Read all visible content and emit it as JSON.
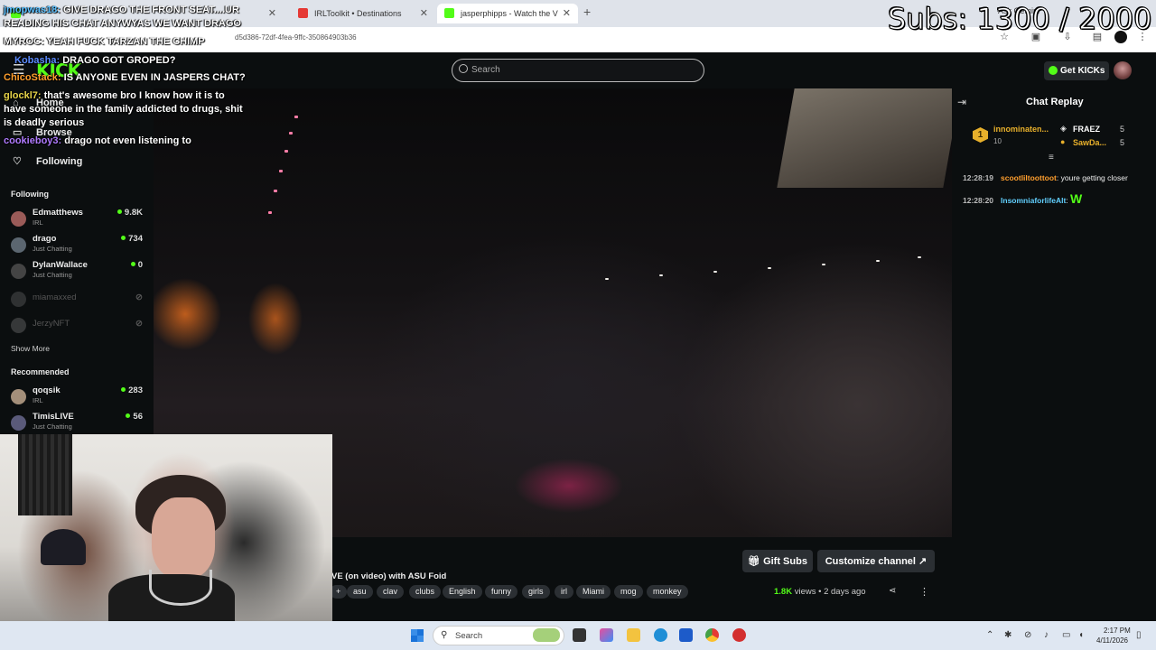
{
  "browser": {
    "tabs": [
      {
        "label": "jmopwas18: GIVE DRAGO THE FRONT SEAT",
        "favicon_color": "#53fc18"
      },
      {
        "label": "IRLToolkit • Destinations",
        "favicon_color": "#e53935"
      },
      {
        "label": "jasperphipps - Watch the V",
        "favicon_color": "#53fc18",
        "active": true
      }
    ],
    "new_tab": "+",
    "url": "d5d386-72df-4fea-9ffc-350864903b36",
    "gemini_label": "Ask Gemini"
  },
  "overlay": {
    "subs_counter": "Subs: 1300 / 2000",
    "chat": [
      {
        "user": "jmopwas18:",
        "text": "GIVE DRAGO THE FRONT SEAT....UR",
        "color": "#5bc0ff"
      },
      {
        "user": "",
        "text": "READING HIS CHAT ANYWYAS WE WANT DRAGO",
        "color": "#ffffff"
      },
      {
        "user": "MYROC:",
        "text": "YEAH FUCK TARZAN THE CHIMP",
        "color": "#ffffff"
      },
      {
        "user": "Kobasha:",
        "text": "DRAGO GOT GROPED?",
        "color": "#5b8bff"
      },
      {
        "user": "ChicoStack:",
        "text": "IS ANYONE EVEN IN JASPERS CHAT?",
        "color": "#ff9f2e"
      },
      {
        "user": "glockl7:",
        "text": "that's awesome bro I know how it is to",
        "color": "#e7d44a"
      },
      {
        "user": "",
        "text": "have someone in the family addicted to drugs, shit",
        "color": "#ffffff"
      },
      {
        "user": "",
        "text": "is deadly serious",
        "color": "#ffffff"
      },
      {
        "user": "cookieboy3:",
        "text": "drago not even listening to",
        "color": "#b07bff"
      }
    ]
  },
  "kick": {
    "logo": "KICK",
    "search_placeholder": "Search",
    "get_kicks": "Get KICKs"
  },
  "sidebar": {
    "nav": [
      {
        "label": "Home",
        "icon": "home-icon"
      },
      {
        "label": "Browse",
        "icon": "browse-icon"
      },
      {
        "label": "Following",
        "icon": "heart-icon"
      }
    ],
    "following_title": "Following",
    "following": [
      {
        "name": "Edmatthews",
        "category": "IRL",
        "viewers": "9.8K",
        "live": true,
        "avatar": "#9a5b58"
      },
      {
        "name": "drago",
        "category": "Just Chatting",
        "viewers": "734",
        "live": true,
        "avatar": "#5b6670"
      },
      {
        "name": "DylanWallace",
        "category": "Just Chatting",
        "viewers": "0",
        "live": true,
        "avatar": "#444"
      },
      {
        "name": "miamaxxed",
        "category": "",
        "viewers": "",
        "live": false,
        "avatar": "#666"
      },
      {
        "name": "JerzyNFT",
        "category": "",
        "viewers": "",
        "live": false,
        "avatar": "#777"
      }
    ],
    "show_more": "Show More",
    "recommended_title": "Recommended",
    "recommended": [
      {
        "name": "qoqsik",
        "category": "IRL",
        "viewers": "283",
        "live": true,
        "avatar": "#a48f7a"
      },
      {
        "name": "TimisLIVE",
        "category": "Just Chatting",
        "viewers": "56",
        "live": true,
        "avatar": "#5a5a7a"
      }
    ]
  },
  "video": {
    "title": "VE (on video) with ASU Foid",
    "tags": [
      "+",
      "asu",
      "clav",
      "clubs",
      "English",
      "funny",
      "girls",
      "irl",
      "Miami",
      "mog",
      "monkey"
    ],
    "views_count": "1.8K",
    "views_label": " views",
    "separator": "•",
    "age": "2 days ago",
    "gift_subs": "Gift Subs",
    "customize": "Customize channel"
  },
  "chat_panel": {
    "title": "Chat Replay",
    "leaderboard": [
      {
        "name": "innominaten...",
        "sub": "10",
        "color": "#e8b02b"
      },
      {
        "name": "FRAEZ",
        "count": "5",
        "color": "#ffffff"
      },
      {
        "name": "SawDa...",
        "count": "5",
        "color": "#e8b02b"
      }
    ],
    "rank": "1",
    "messages": [
      {
        "time": "12:28:19",
        "user": "scootliltoottoot",
        "text": "youre getting closer",
        "color": "#ff9f2e"
      },
      {
        "time": "12:28:20",
        "user": "InsomniaforlifeAlt",
        "text": "W",
        "color": "#62d0ff"
      }
    ]
  },
  "taskbar": {
    "search": "Search",
    "time": "2:17 PM",
    "date": "4/11/2026"
  }
}
